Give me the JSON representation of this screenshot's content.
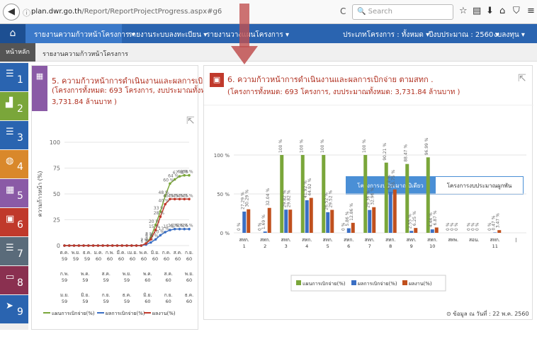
{
  "browser": {
    "url_host": "plan.dwr.go.th",
    "url_path": "/Report/ReportProjectProgress.aspx#g6",
    "search_placeholder": "Search",
    "icons": [
      "back-icon",
      "info-icon",
      "reload-icon",
      "search-icon",
      "star-icon",
      "reading-list-icon",
      "download-icon",
      "home-icon",
      "shield-icon",
      "menu-icon"
    ]
  },
  "nav": {
    "items": [
      "รายงานความก้าวหน้าโครงการ ▾",
      "รายงานระบบลงทะเบียน ▾",
      "รายงานวางแผนโครงการ ▾"
    ],
    "filters": [
      "ประเภทโครงการ : ทั้งหมด ▾",
      "ปีงบประมาณ : 2560 ▾",
      "งบลงทุน ▾"
    ]
  },
  "breadcrumb": {
    "home": "หน้าหลัก",
    "current": "รายงานความก้าวหน้าโครงการ"
  },
  "sidebar": [
    "1",
    "2",
    "3",
    "4",
    "5",
    "6",
    "7",
    "8",
    "9"
  ],
  "panel5": {
    "title": "5. ความก้าวหน้าการดำเนินงานและผลการเบิกจ่าย",
    "subtitle1": "(โครงการทั้งหมด: 693 โครงการ, งบประมาณทั้งหมด:",
    "subtitle2": "3,731.84 ล้านบาท )"
  },
  "panel6": {
    "title": "6. ความก้าวหน้าการดำเนินงานและผลการเบิกจ่าย ตามสทก .",
    "subtitle": "(โครงการทั้งหมด: 693 โครงการ, งบประมาณทั้งหมด: 3,731.84 ล้านบาท )",
    "tabs": [
      "โครงการงบประมาณปีเดียว",
      "โครงการงบประมาณผูกพัน"
    ],
    "footnote": "⊙ ข้อมูล ณ วันที่ : 22 พ.ค. 2560"
  },
  "chart_data": [
    {
      "type": "line",
      "ylabel": "ความก้าวหน้า (%)",
      "yticks": [
        "0",
        "25",
        "50",
        "75",
        "100"
      ],
      "ylim": [
        0,
        100
      ],
      "x_month_row1": [
        "ต.ค.",
        "พ.ย.",
        "ธ.ค.",
        "ม.ค.",
        "ก.พ.",
        "มี.ค.",
        "เม.ย.",
        "พ.ค.",
        "มิ.ย.",
        "ก.ค.",
        "ส.ค.",
        "ก.ย."
      ],
      "x_year_row1": [
        "59",
        "59",
        "59",
        "60",
        "60",
        "60",
        "60",
        "60",
        "60",
        "60",
        "60",
        "60"
      ],
      "x_months_top": [
        "ต.ค.",
        "พ.ย.",
        "ก.พ.",
        "ก.ค.",
        "พ.ย.",
        "ม.ค.",
        "ต.ค."
      ],
      "x_years_top": [
        "59",
        "59",
        "59",
        "59",
        "60",
        "60",
        "60"
      ],
      "x_months_mid": [
        "ก.พ.",
        "พ.ค.",
        "ส.ค.",
        "พ.ย.",
        "พ.ค.",
        "ส.ค.",
        "พ.ย."
      ],
      "x_years_mid": [
        "59",
        "59",
        "59",
        "59",
        "60",
        "60",
        "60"
      ],
      "x_months_bot": [
        "ม.ย.",
        "มิ.ย.",
        "ก.ย.",
        "ธ.ค.",
        "มิ.ย.",
        "ก.ย.",
        "ธ.ค."
      ],
      "x_years_bot": [
        "59",
        "59",
        "59",
        "59",
        "60",
        "60",
        "60"
      ],
      "series": [
        {
          "name": "แผนการเบิกจ่าย(%)",
          "color": "#7aa63a",
          "values": [
            0,
            0,
            0,
            0,
            0,
            0,
            0,
            0,
            0,
            0,
            0,
            0,
            0,
            0,
            0,
            0,
            0,
            2,
            8,
            20,
            33,
            48,
            60,
            64,
            67,
            68,
            68
          ]
        },
        {
          "name": "ผลการเบิกจ่าย(%)",
          "color": "#3a6fc4",
          "values": [
            0,
            0,
            0,
            0,
            0,
            0,
            0,
            0,
            0,
            0,
            0,
            0,
            0,
            0,
            0,
            0,
            0,
            1,
            3,
            6,
            10,
            13,
            15,
            16,
            16,
            16,
            16
          ]
        },
        {
          "name": "ผลงาน(%)",
          "color": "#c0392b",
          "values": [
            0,
            0,
            0,
            0,
            0,
            0,
            0,
            0,
            0,
            0,
            0,
            0,
            0,
            0,
            0,
            0,
            0,
            2,
            6,
            15,
            28,
            40,
            45,
            45,
            45,
            45,
            45
          ]
        }
      ]
    },
    {
      "type": "bar",
      "yticks": [
        "0 %",
        "50 %",
        "100 %"
      ],
      "ylim": [
        0,
        100
      ],
      "categories": [
        "สทก. 1",
        "สทก. 2",
        "สทก. 3",
        "สทก. 4",
        "สทก. 5",
        "สทก. 6",
        "สทก. 7",
        "สทก. 8",
        "สทก. 9",
        "สทก. 10",
        "สทพ.",
        "สอน.",
        "สทก. 11",
        "|"
      ],
      "series": [
        {
          "name": "แผนการเบิกจ่าย(%)",
          "color": "#7aa63a",
          "values": [
            0,
            0,
            100,
            100,
            100,
            0,
            100,
            90.21,
            88.47,
            96.99,
            0,
            0,
            0,
            0
          ],
          "labels": [
            "0 %",
            "0 %",
            "100 %",
            "100 %",
            "100 %",
            "0 %",
            "100 %",
            "90.21 %",
            "88.47 %",
            "96.99 %",
            "0 %",
            "0 %",
            "0 %",
            ""
          ]
        },
        {
          "name": "ผลการเบิกจ่าย(%)",
          "color": "#3a6fc4",
          "values": [
            27.29,
            1.69,
            29.82,
            41.92,
            26.52,
            5.86,
            29.36,
            52.7,
            2.55,
            4.44,
            0,
            0,
            0.47,
            0
          ],
          "labels": [
            "27.29 %",
            "1.69 %",
            "29.82 %",
            "41.92 %",
            "26.52 %",
            "5.86 %",
            "29.36 %",
            "52.7 %",
            "2.55 %",
            "4.44 %",
            "0 %",
            "0 %",
            "0.47 %",
            ""
          ]
        },
        {
          "name": "ผลงาน(%)",
          "color": "#c0501e",
          "values": [
            30.29,
            32.04,
            29.82,
            44.92,
            29.52,
            12.86,
            32.96,
            55.75,
            6.25,
            6.87,
            0,
            0,
            3.47,
            0
          ],
          "labels": [
            "30.29 %",
            "32.04 %",
            "29.82 %",
            "44.92 %",
            "29.52 %",
            "12.86 %",
            "32.96 %",
            "55.75 %",
            "6.25 %",
            "6.87 %",
            "0 %",
            "0 %",
            "3.47 %",
            ""
          ]
        }
      ]
    }
  ]
}
